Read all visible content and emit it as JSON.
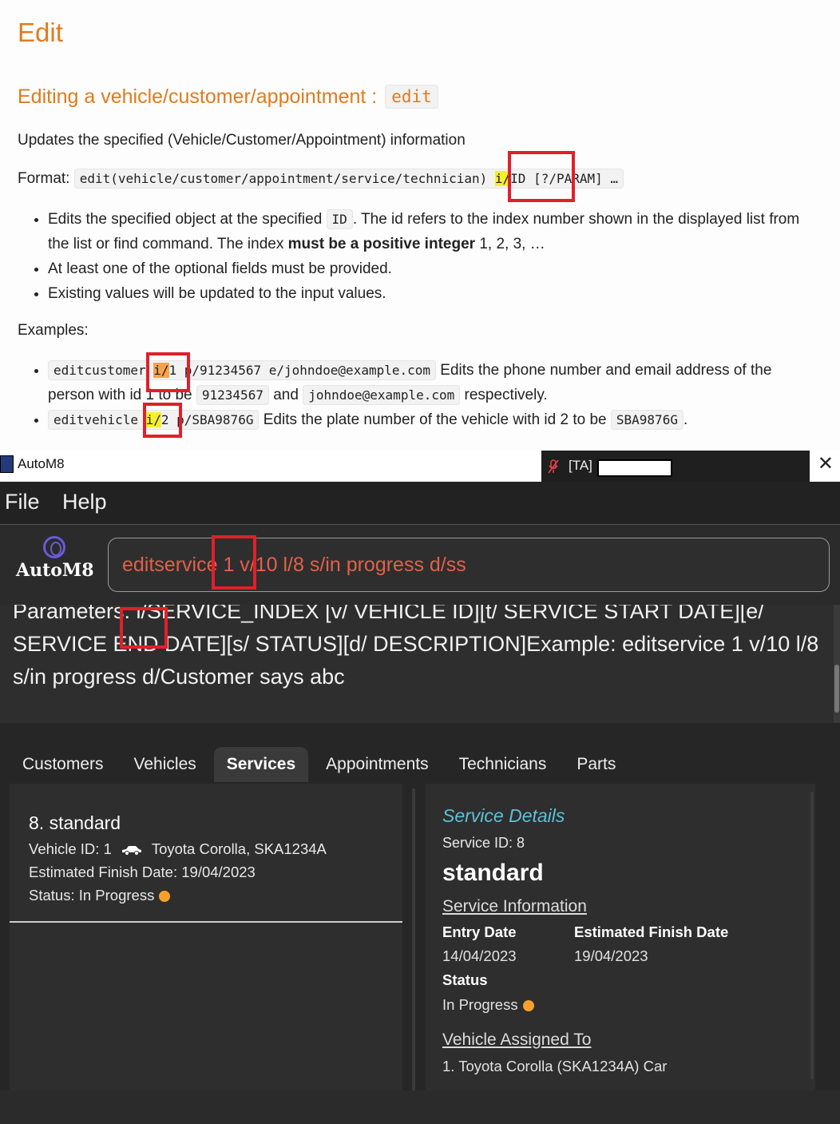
{
  "doc": {
    "heading": "Edit",
    "subheading_text": "Editing a vehicle/customer/appointment :",
    "subheading_code": "edit",
    "description": "Updates the specified (Vehicle/Customer/Appointment) information",
    "format_label": "Format:",
    "format_code_pre": "edit(vehicle/customer/appointment/service/technician) ",
    "format_code_hl": "i/",
    "format_code_post": "ID [?/PARAM] …",
    "bullets": {
      "b1_pre": "Edits the specified object at the specified ",
      "b1_code": "ID",
      "b1_mid": ". The id refers to the index number shown in the displayed list from the list or find command. The index ",
      "b1_bold": "must be a positive integer",
      "b1_post": " 1, 2, 3, …",
      "b2": "At least one of the optional fields must be provided.",
      "b3": "Existing values will be updated to the input values."
    },
    "examples_label": "Examples:",
    "ex1": {
      "code_pre": "editcustomer ",
      "code_hl": "i/",
      "code_post": "1 p/91234567 e/johndoe@example.com",
      "text_a": " Edits the phone number and email address of the person with id 1 to be ",
      "code2": "91234567",
      "text_b": " and ",
      "code3": "johndoe@example.com",
      "text_c": " respectively."
    },
    "ex2": {
      "code_pre": "editvehicle ",
      "code_hl": "i/",
      "code_post": "2 p/SBA9876G",
      "text_a": " Edits the plate number of the vehicle with id 2 to be ",
      "code2": "SBA9876G",
      "text_b": "."
    }
  },
  "window": {
    "title": "AutoM8",
    "ta_label": "[TA]",
    "close_glyph": "✕"
  },
  "menu": {
    "file": "File",
    "help": "Help"
  },
  "logo_text": "AutoM8",
  "command": {
    "value": "editservice 1 v/10 l/8 s/in progress d/ss"
  },
  "result": {
    "text": "Parameters: i/SERVICE_INDEX [v/ VEHICLE ID][t/ SERVICE START DATE][e/ SERVICE END DATE][s/ STATUS][d/ DESCRIPTION]Example: editservice 1 v/10 l/8 s/in progress d/Customer says abc"
  },
  "tabs": [
    "Customers",
    "Vehicles",
    "Services",
    "Appointments",
    "Technicians",
    "Parts"
  ],
  "active_tab": "Services",
  "service_card": {
    "title": "8.  standard",
    "vehicle_pre": "Vehicle ID: 1",
    "vehicle_post": "Toyota Corolla, SKA1234A",
    "finish": "Estimated Finish Date: 19/04/2023",
    "status": "Status: In Progress"
  },
  "details": {
    "heading": "Service Details",
    "service_id": "Service ID: 8",
    "name": "standard",
    "info_section": "Service Information",
    "entry_label": "Entry Date",
    "entry_value": "14/04/2023",
    "finish_label": "Estimated Finish Date",
    "finish_value": "19/04/2023",
    "status_label": "Status",
    "status_value": "In Progress",
    "vehicle_section": "Vehicle Assigned To",
    "vehicle_value": "1. Toyota Corolla (SKA1234A) Car"
  },
  "colors": {
    "status_dot": "#f6a12a",
    "highlight_box": "#e0202a",
    "heading": "#e07b1e",
    "command_text": "#e2604a",
    "details_heading": "#5bc0d6"
  }
}
